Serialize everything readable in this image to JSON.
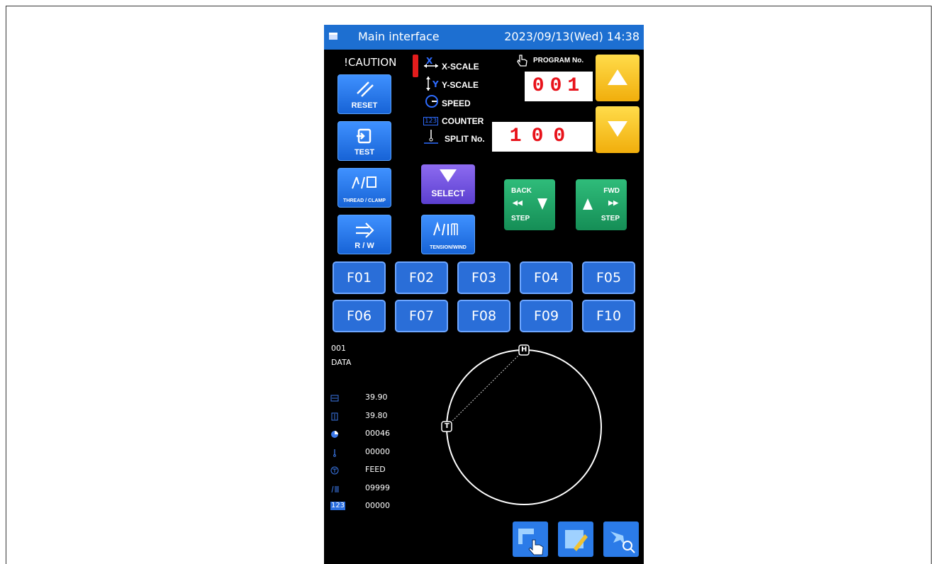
{
  "window": {
    "title": "Main interface",
    "datetime": "2023/09/13(Wed) 14:38"
  },
  "caution": "!CAUTION",
  "legend": {
    "x_scale": "X-SCALE",
    "y_scale": "Y-SCALE",
    "speed": "SPEED",
    "counter": "COUNTER",
    "split": "SPLIT No.",
    "x_letter": "X",
    "y_letter": "Y",
    "counter_icon": "123"
  },
  "program": {
    "label": "PROGRAM No.",
    "value": "001"
  },
  "split": {
    "value": "100"
  },
  "buttons": {
    "reset": "RESET",
    "test": "TEST",
    "thread_clamp": "THREAD / CLAMP",
    "rw": "R / W",
    "select": "SELECT",
    "tension_wind": "TENSION/WIND",
    "back": "BACK",
    "back_step": "STEP",
    "fwd": "FWD",
    "fwd_step": "STEP"
  },
  "function_keys": [
    "F01",
    "F02",
    "F03",
    "F04",
    "F05",
    "F06",
    "F07",
    "F08",
    "F09",
    "F10"
  ],
  "data_panel": {
    "program": "001",
    "name": "DATA",
    "rows": [
      {
        "icon": "x-scale-icon",
        "value": "39.90"
      },
      {
        "icon": "y-scale-icon",
        "value": "39.80"
      },
      {
        "icon": "speed-icon",
        "value": "00046"
      },
      {
        "icon": "needle-icon",
        "value": "00000"
      },
      {
        "icon": "tension-icon",
        "value": "FEED"
      },
      {
        "icon": "wind-icon",
        "value": "09999"
      },
      {
        "icon": "counter-icon",
        "value": "00000"
      }
    ],
    "counter_icon_text": "123"
  },
  "pattern": {
    "start_marker": "H",
    "end_marker": "T"
  },
  "colors": {
    "titlebar": "#1d6fd1",
    "display_digits": "#e8121a",
    "accent_yellow": "#f1ae0c",
    "select_purple": "#6f52e0",
    "step_green": "#1fa566"
  }
}
